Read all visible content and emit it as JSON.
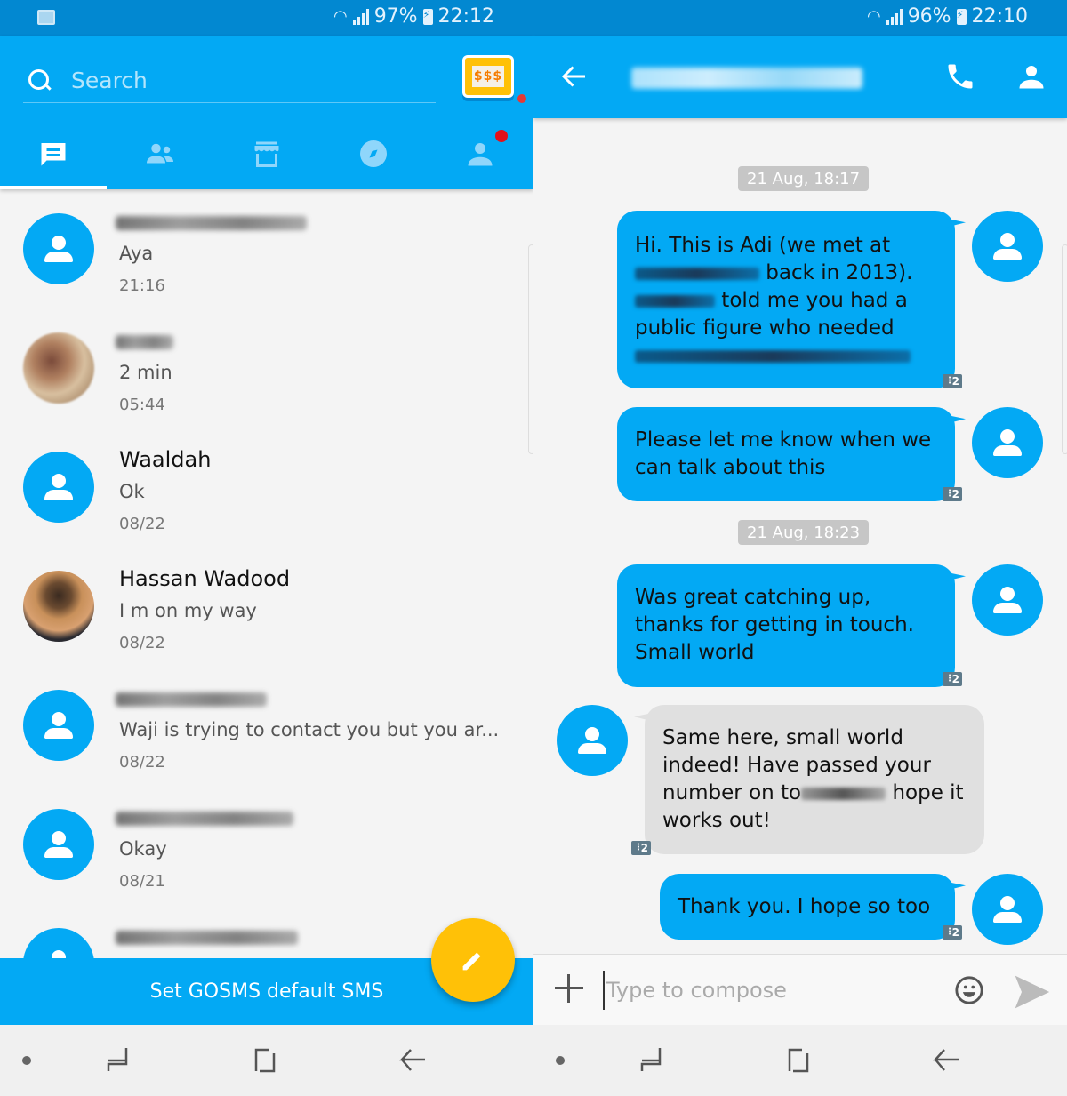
{
  "left": {
    "status": {
      "battery": "97%",
      "time": "22:12"
    },
    "search": {
      "placeholder": "Search"
    },
    "tabs": [
      {
        "id": "messages",
        "icon": "message-icon",
        "active": true
      },
      {
        "id": "contacts",
        "icon": "contacts-icon",
        "active": false
      },
      {
        "id": "store",
        "icon": "store-icon",
        "active": false
      },
      {
        "id": "discover",
        "icon": "compass-icon",
        "active": false
      },
      {
        "id": "profile",
        "icon": "profile-icon",
        "active": false,
        "badge": true
      }
    ],
    "conversations": [
      {
        "name": "[redacted]",
        "preview": "Aya",
        "time": "21:16",
        "avatar": "default"
      },
      {
        "name": "[redacted]",
        "preview": "2 min",
        "time": "05:44",
        "avatar": "photo"
      },
      {
        "name": "Waaldah",
        "preview": "Ok",
        "time": "08/22",
        "avatar": "default"
      },
      {
        "name": "Hassan Wadood",
        "preview": "I m on my way",
        "time": "08/22",
        "avatar": "photo"
      },
      {
        "name": "[redacted]",
        "preview": "Waji is trying to contact you but you ar...",
        "time": "08/22",
        "avatar": "default"
      },
      {
        "name": "[redacted]",
        "preview": "Okay",
        "time": "08/21",
        "avatar": "default"
      },
      {
        "name": "[redacted]",
        "preview": "",
        "time": "",
        "avatar": "default"
      }
    ],
    "default_bar": "Set GOSMS default SMS"
  },
  "right": {
    "status": {
      "battery": "96%",
      "time": "22:10"
    },
    "contact_name": "[redacted]",
    "dates": [
      "21 Aug, 18:17",
      "21 Aug, 18:23"
    ],
    "messages": [
      {
        "direction": "out",
        "parts": [
          "Hi. This is Adi (we met at",
          " back in 2013).",
          " told me you had a",
          "public figure who needed"
        ],
        "sim": "2"
      },
      {
        "direction": "out",
        "text": "Please let me know when we can talk about this",
        "sim": "2"
      },
      {
        "direction": "out",
        "text": "Was great catching up, thanks for getting in touch. Small world",
        "sim": "2"
      },
      {
        "direction": "in",
        "parts": [
          "Same here, small world indeed! Have passed your number on to",
          " hope it works out!"
        ],
        "sim": "2"
      },
      {
        "direction": "out",
        "text": "Thank you. I hope so too",
        "sim": "2"
      }
    ],
    "compose": {
      "placeholder": "Type to compose"
    }
  },
  "colors": {
    "primary": "#03a9f4",
    "status_bar": "#0288d1",
    "fab": "#ffc107",
    "incoming_bubble": "#e0e0e0",
    "badge": "#e3101a"
  }
}
